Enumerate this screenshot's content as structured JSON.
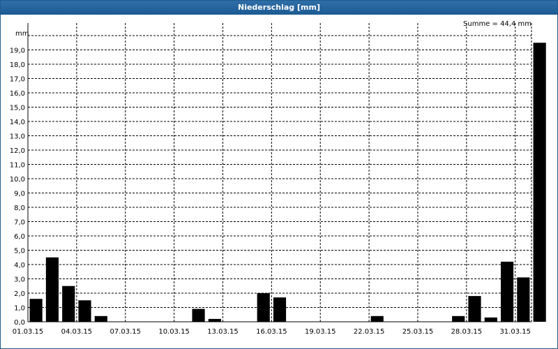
{
  "window": {
    "title": "Niederschlag [mm]"
  },
  "colors": {
    "titlebar": "#1f5f99",
    "bar": "#000000",
    "grid": "#000000"
  },
  "chart_data": {
    "type": "bar",
    "title": "Niederschlag [mm]",
    "unit_label": "mm",
    "annotation": "Summe = 44,4 mm",
    "grid": true,
    "ylim": [
      0,
      20
    ],
    "yticks": [
      "0,0",
      "1,0",
      "2,0",
      "3,0",
      "4,0",
      "5,0",
      "6,0",
      "7,0",
      "8,0",
      "9,0",
      "10,0",
      "11,0",
      "12,0",
      "13,0",
      "14,0",
      "15,0",
      "16,0",
      "17,0",
      "18,0",
      "19,0"
    ],
    "xtick_labels": [
      "01.03.15",
      "04.03.15",
      "07.03.15",
      "10.03.15",
      "13.03.15",
      "16.03.15",
      "19.03.15",
      "22.03.15",
      "25.03.15",
      "28.03.15",
      "31.03.15"
    ],
    "categories": [
      "01.03.15",
      "02.03.15",
      "03.03.15",
      "04.03.15",
      "05.03.15",
      "06.03.15",
      "07.03.15",
      "08.03.15",
      "09.03.15",
      "10.03.15",
      "11.03.15",
      "12.03.15",
      "13.03.15",
      "14.03.15",
      "15.03.15",
      "16.03.15",
      "17.03.15",
      "18.03.15",
      "19.03.15",
      "20.03.15",
      "21.03.15",
      "22.03.15",
      "23.03.15",
      "24.03.15",
      "25.03.15",
      "26.03.15",
      "27.03.15",
      "28.03.15",
      "29.03.15",
      "30.03.15",
      "31.03.15"
    ],
    "values": [
      1.6,
      4.5,
      2.5,
      1.5,
      0.4,
      0,
      0,
      0,
      0,
      0,
      0.9,
      0.2,
      0,
      0,
      2.0,
      1.7,
      0,
      0,
      0,
      0,
      0,
      0.4,
      0,
      0,
      0,
      0,
      0.4,
      1.8,
      0.3,
      4.2,
      3.1,
      19.5
    ]
  }
}
